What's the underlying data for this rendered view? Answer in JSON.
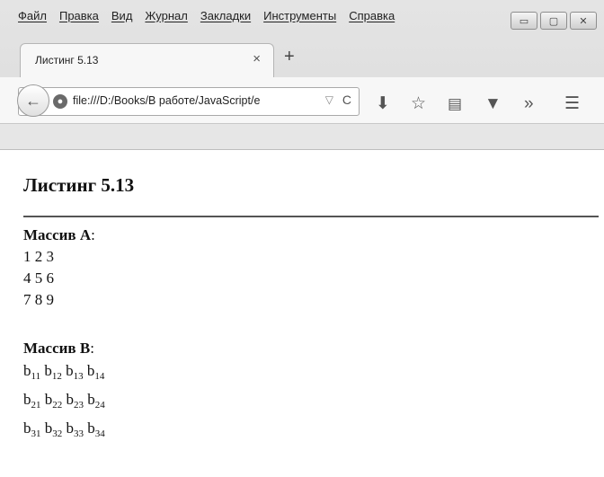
{
  "menu": [
    "Файл",
    "Правка",
    "Вид",
    "Журнал",
    "Закладки",
    "Инструменты",
    "Справка"
  ],
  "window_controls": {
    "minimize": "▭",
    "maximize": "▢",
    "close": "✕"
  },
  "tab": {
    "title": "Листинг 5.13",
    "close": "×",
    "new_tab": "+"
  },
  "urlbar": {
    "url": "file:///D:/Books/В работе/JavaScript/e",
    "dropdown": "▽",
    "reload": "C"
  },
  "toolbar_icons": [
    "download-icon",
    "star-icon",
    "reading-list-icon",
    "pocket-icon",
    "overflow-icon",
    "menu-icon"
  ],
  "page": {
    "title": "Листинг 5.13",
    "array_a": {
      "label": "Массив A",
      "colon": ":",
      "rows": [
        "1 2 3",
        "4 5 6",
        "7 8 9"
      ]
    },
    "array_b": {
      "label": "Массив B",
      "colon": ":",
      "base": "b",
      "rows": [
        [
          "11",
          "12",
          "13",
          "14"
        ],
        [
          "21",
          "22",
          "23",
          "24"
        ],
        [
          "31",
          "32",
          "33",
          "34"
        ]
      ]
    }
  }
}
